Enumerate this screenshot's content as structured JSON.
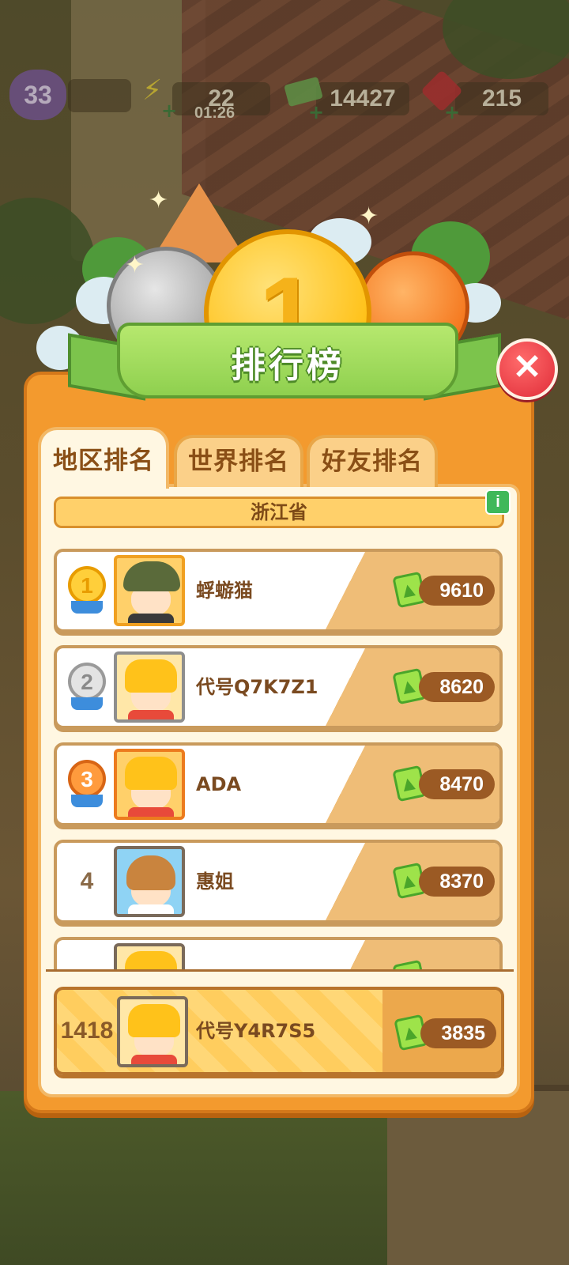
{
  "status": {
    "level": "33",
    "energy": "22",
    "energy_timer": "01:26",
    "cash": "14427",
    "gems": "215"
  },
  "header": {
    "medal_number": "1",
    "title": "排行榜",
    "close_symbol": "✕"
  },
  "tabs": [
    {
      "label": "地区排名",
      "active": true
    },
    {
      "label": "世界排名",
      "active": false
    },
    {
      "label": "好友排名",
      "active": false
    }
  ],
  "region": {
    "name": "浙江省",
    "info_symbol": "i"
  },
  "leaderboard": [
    {
      "rank": "1",
      "name": "蜉蝣猫",
      "score": "9610"
    },
    {
      "rank": "2",
      "name": "代号Q7K7Z1",
      "score": "8620"
    },
    {
      "rank": "3",
      "name": "ADA",
      "score": "8470"
    },
    {
      "rank": "4",
      "name": "惠姐",
      "score": "8370"
    }
  ],
  "self": {
    "rank": "1418",
    "name": "代号Y4R7S5",
    "score": "3835"
  },
  "colors": {
    "panel": "#f39a2e",
    "banner": "#8fd04f",
    "close": "#e02c38",
    "score_pill": "#9b5a24"
  }
}
